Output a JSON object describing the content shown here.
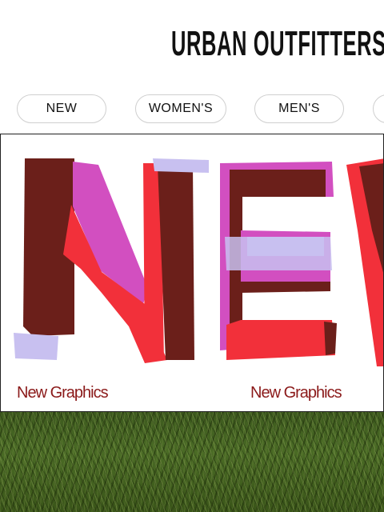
{
  "header": {
    "logo_text": "URBAN OUTFITTERS"
  },
  "nav": {
    "items": [
      {
        "label": "NEW"
      },
      {
        "label": "WOMEN'S"
      },
      {
        "label": "MEN'S"
      },
      {
        "label": ""
      }
    ]
  },
  "hero": {
    "captions": [
      "New Graphics",
      "New Graphics"
    ],
    "artwork_letters": "NEW",
    "colors": {
      "brown": "#6b1f1a",
      "red": "#f2303a",
      "magenta": "#d24fc0",
      "lavender": "#c8c0f0",
      "caption": "#8b1a1a"
    }
  },
  "footer_image": {
    "subject": "grass"
  }
}
